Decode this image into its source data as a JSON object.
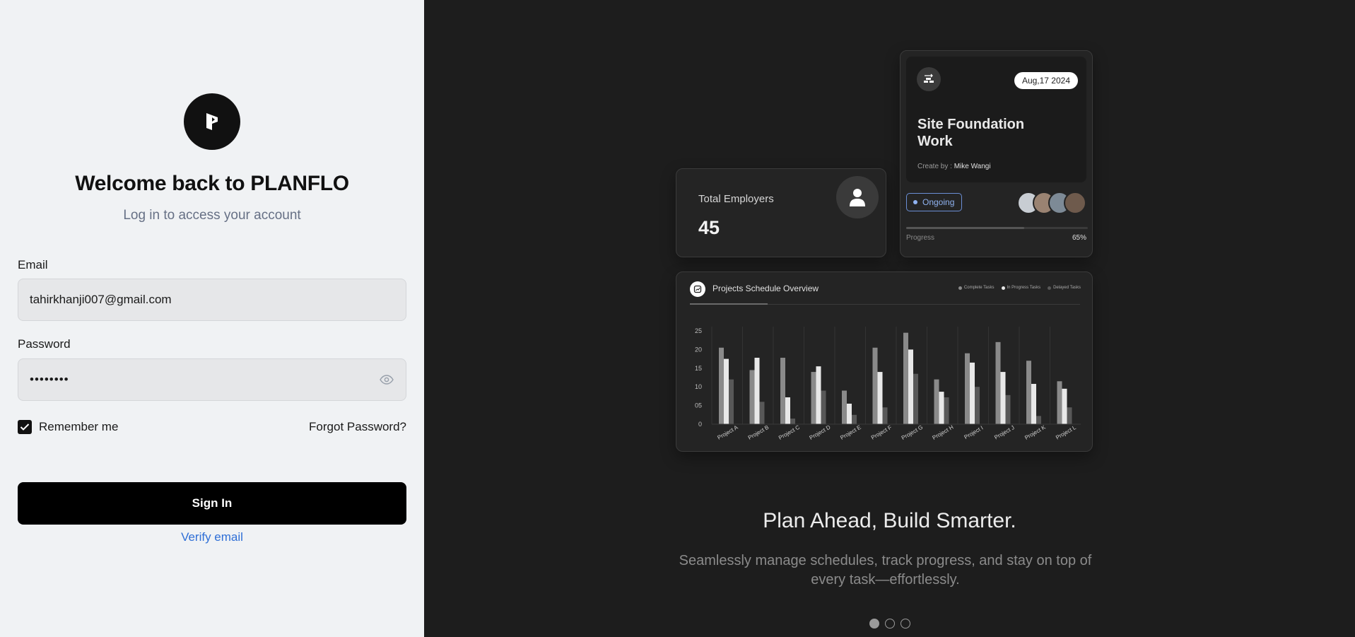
{
  "login": {
    "welcome": "Welcome back to PLANFLO",
    "subtitle": "Log in to access your account",
    "email_label": "Email",
    "email_value": "tahirkhanji007@gmail.com",
    "password_label": "Password",
    "password_value": "••••••••",
    "remember_label": "Remember me",
    "remember_checked": true,
    "forgot_label": "Forgot Password?",
    "signin_label": "Sign In",
    "verify_label": "Verify email"
  },
  "showcase": {
    "employees": {
      "title": "Total Employers",
      "value": "45"
    },
    "task": {
      "date": "Aug,17 2024",
      "title": "Site Foundation Work",
      "created_prefix": "Create by : ",
      "created_by": "Mike Wangi",
      "status": "Ongoing",
      "progress_label": "Progress",
      "progress_value": "65%",
      "progress": 0.65
    },
    "chart_title": "Projects Schedule Overview",
    "headline": "Plan Ahead, Build Smarter.",
    "body": "Seamlessly manage schedules, track progress, and stay on top of every task—effortlessly.",
    "carousel_active": 0
  },
  "chart_data": {
    "type": "bar",
    "title": "Projects Schedule Overview",
    "categories": [
      "Project A",
      "Project B",
      "Project C",
      "Project D",
      "Project E",
      "Project F",
      "Project G",
      "Project H",
      "Project I",
      "Project J",
      "Project K",
      "Project L"
    ],
    "series": [
      {
        "name": "Complete Tasks",
        "color": "#8a8a8a",
        "values": [
          20.5,
          14.5,
          17.8,
          14,
          9,
          20.5,
          24.5,
          12,
          19,
          22,
          17,
          11.5
        ]
      },
      {
        "name": "In Progress Tasks",
        "color": "#e8e8e8",
        "values": [
          17.5,
          17.8,
          7.2,
          15.5,
          5.5,
          14,
          20,
          8.7,
          16.5,
          14,
          10.8,
          9.5
        ]
      },
      {
        "name": "Delayed Tasks",
        "color": "#585858",
        "values": [
          12,
          6,
          1.5,
          9,
          2.5,
          4.5,
          13.5,
          7.2,
          10,
          7.8,
          2.2,
          4.5
        ]
      }
    ],
    "yticks": [
      "0",
      "05",
      "10",
      "15",
      "20",
      "25"
    ],
    "ylim": [
      0,
      25
    ],
    "grid": true,
    "legend": "top-right"
  }
}
